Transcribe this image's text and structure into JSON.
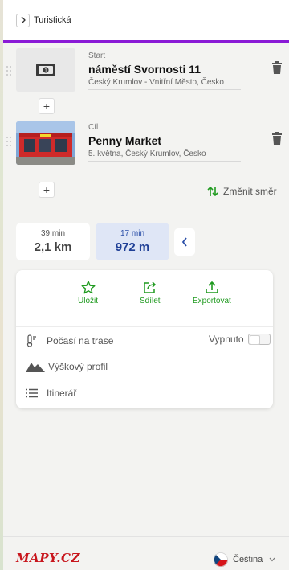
{
  "header": {
    "breadcrumb_label": "Turistická"
  },
  "waypoints": [
    {
      "kind": "Start",
      "title": "náměstí Svornosti 11",
      "subtitle": "Český Krumlov - Vnitřní Město, Česko"
    },
    {
      "kind": "Cíl",
      "title": "Penny Market",
      "subtitle": "5. května, Český Krumlov, Česko"
    }
  ],
  "add_label": "+",
  "swap_label": "Změnit směr",
  "route_options": [
    {
      "time": "39 min",
      "distance": "2,1 km"
    },
    {
      "time": "17 min",
      "distance": "972 m"
    }
  ],
  "actions": {
    "save": "Uložit",
    "share": "Sdílet",
    "export": "Exportovat"
  },
  "rows": {
    "weather": "Počasí na trase",
    "weather_state": "Vypnuto",
    "elevation": "Výškový profil",
    "itinerary": "Itinerář"
  },
  "footer": {
    "logo": "MAPY.CZ",
    "language": "Čeština"
  },
  "colors": {
    "accent_line": "#8a1ad6",
    "action_green": "#1f9a1f",
    "selected_option_bg": "#dfe6f6",
    "logo_red": "#c8161d"
  }
}
